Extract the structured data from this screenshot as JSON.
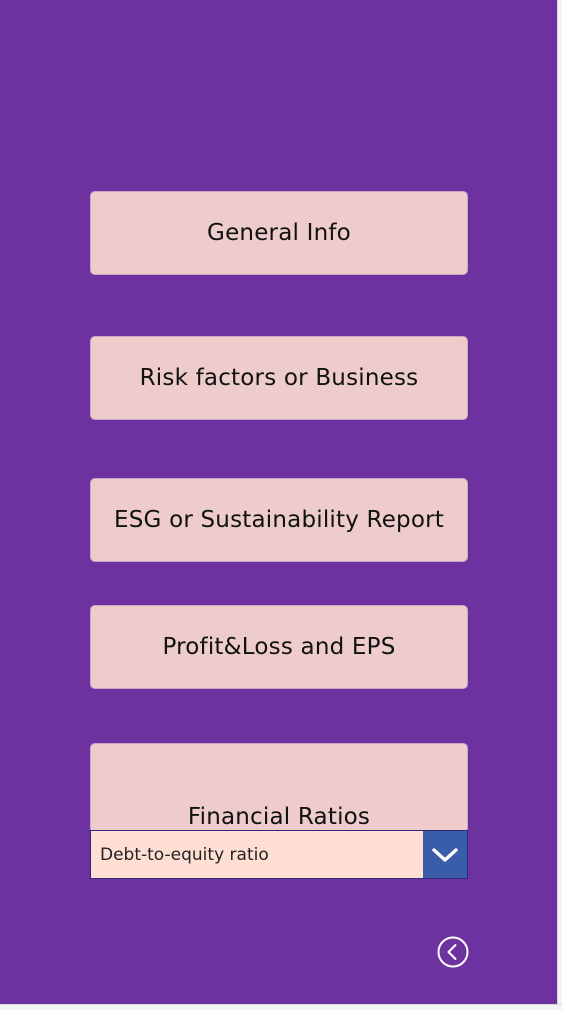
{
  "menu": {
    "general_info": "General Info",
    "risk_factors": "Risk factors or Business",
    "esg": "ESG or Sustainability Report",
    "profit_loss": "Profit&Loss and EPS",
    "financial_ratios": "Financial Ratios"
  },
  "ratio_select": {
    "selected": "Debt-to-equity ratio",
    "icon": "chevron-down-icon"
  },
  "back": {
    "icon": "back-arrow-circle-icon"
  },
  "colors": {
    "background": "#6e31a0",
    "button_fill": "#edcccb",
    "dropdown_fill": "#ffdfd3",
    "dropdown_chevron": "#3a5da9"
  }
}
